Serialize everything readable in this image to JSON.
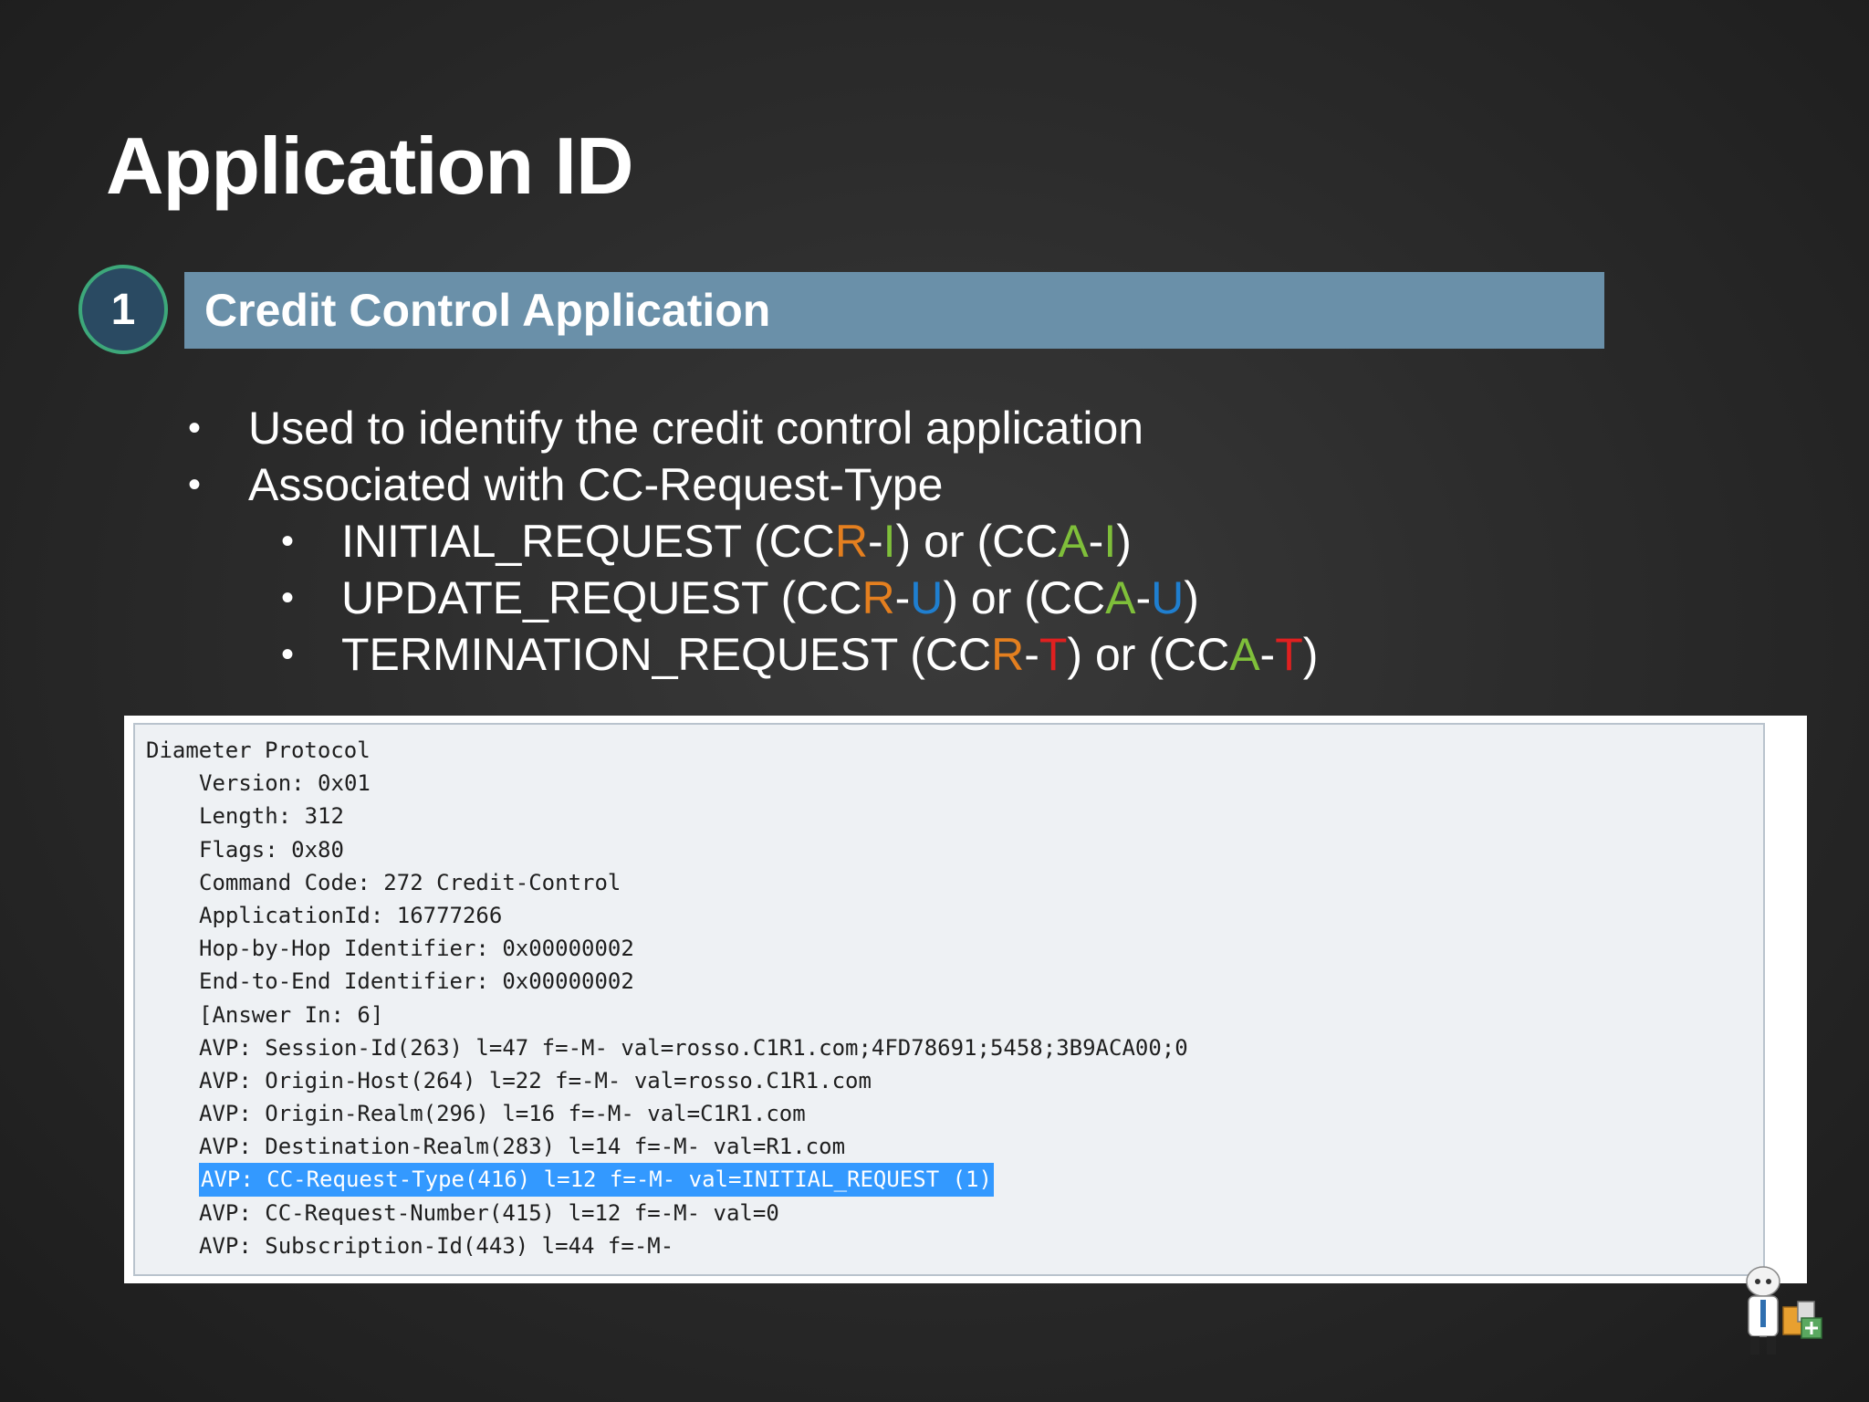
{
  "slide": {
    "title": "Application ID"
  },
  "section": {
    "number": "1",
    "heading": "Credit Control Application"
  },
  "bullets": {
    "item1": "Used to identify the credit control application",
    "item2": "Associated with CC-Request-Type",
    "initial": {
      "name": "INITIAL_REQUEST",
      "request_prefix": "CCR",
      "answer_prefix": "CCA",
      "letter": "I",
      "connector": "or"
    },
    "update": {
      "name": "UPDATE_REQUEST",
      "request_prefix": "CCR",
      "answer_prefix": "CCA",
      "letter": "U",
      "connector": "or"
    },
    "termination": {
      "name": "TERMINATION_REQUEST",
      "request_prefix": "CCR",
      "answer_prefix": "CCA",
      "letter": "T",
      "connector": "or"
    }
  },
  "colors": {
    "title_bar": "#6a90a9",
    "circle_fill": "#2a4a62",
    "circle_border": "#3da87a",
    "r_letter": "#e47f1f",
    "a_letter": "#7fbf3a",
    "initial_letter": "#7fbf3a",
    "update_letter": "#1f7fd0",
    "termination_letter": "#e02020",
    "highlight": "#3399ff"
  },
  "packet": {
    "lines": [
      "Diameter Protocol",
      "Version: 0x01",
      "Length: 312",
      "Flags: 0x80",
      "Command Code: 272 Credit-Control",
      "ApplicationId: 16777266",
      "Hop-by-Hop Identifier: 0x00000002",
      "End-to-End Identifier: 0x00000002",
      "[Answer In: 6]",
      "AVP: Session-Id(263) l=47 f=-M- val=rosso.C1R1.com;4FD78691;5458;3B9ACA00;0",
      "AVP: Origin-Host(264) l=22 f=-M- val=rosso.C1R1.com",
      "AVP: Origin-Realm(296) l=16 f=-M- val=C1R1.com",
      "AVP: Destination-Realm(283) l=14 f=-M- val=R1.com",
      "AVP: CC-Request-Type(416) l=12 f=-M- val=INITIAL_REQUEST (1)",
      "AVP: CC-Request-Number(415) l=12 f=-M- val=0",
      "AVP: Subscription-Id(443) l=44 f=-M-"
    ],
    "highlighted_line": "AVP: CC-Request-Type(416) l=12 f=-M- val=INITIAL_REQUEST (1)"
  },
  "icons": {
    "bullet": "bullet-dot",
    "mascot": "mascot-icon"
  }
}
